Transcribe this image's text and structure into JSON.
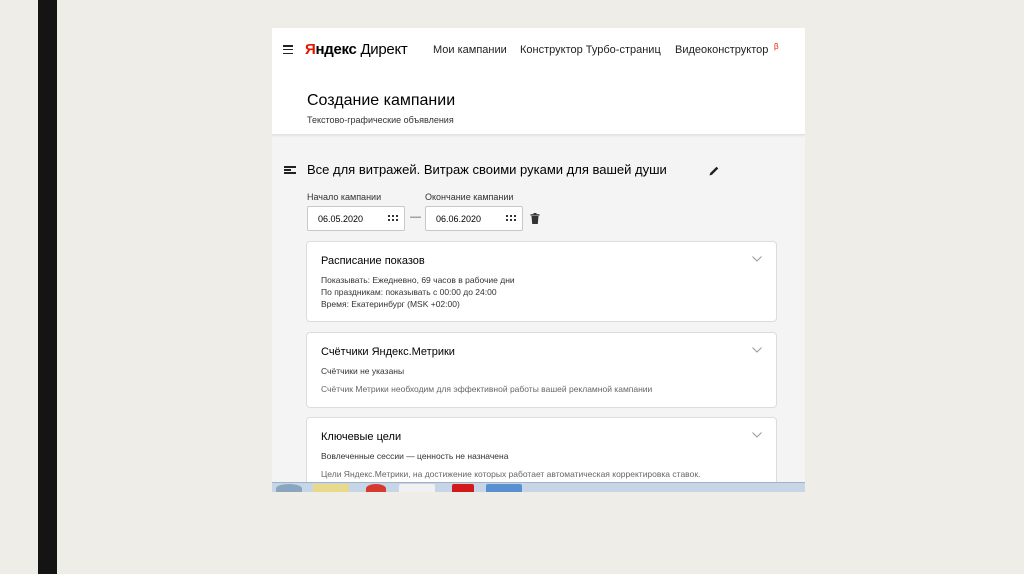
{
  "topnav": {
    "logo_ya": "Я",
    "logo_ndex": "ндекс",
    "logo_direct": "Директ",
    "items": [
      "Мои кампании",
      "Конструктор Турбо-страниц",
      "Видеоконструктор"
    ],
    "beta_label": "β"
  },
  "header": {
    "title": "Создание кампании",
    "subtitle": "Текстово-графические объявления"
  },
  "campaign": {
    "name": "Все для витражей. Витраж своими руками для вашей души"
  },
  "dates": {
    "start_label": "Начало кампании",
    "start_value": "06.05.2020",
    "end_label": "Окончание кампании",
    "end_value": "06.06.2020",
    "separator": "—"
  },
  "panels": {
    "schedule": {
      "title": "Расписание показов",
      "lines": [
        "Показывать: Ежедневно, 69 часов в рабочие дни",
        "По праздникам: показывать с 00:00 до 24:00",
        "Время: Екатеринбург (MSK +02:00)"
      ]
    },
    "metrika": {
      "title": "Счётчики Яндекс.Метрики",
      "lines": [
        "Счётчики не указаны",
        "Счётчик Метрики необходим для эффективной работы вашей рекламной кампании"
      ]
    },
    "goals": {
      "title": "Ключевые цели",
      "lines": [
        "Вовлеченные сессии — ценность не назначена",
        "Цели Яндекс.Метрики, на достижение которых работает автоматическая корректировка ставок."
      ]
    }
  },
  "colors": {
    "brand_red": "#e61400",
    "page_bg": "#efede8",
    "content_bg": "#f4f4f4"
  }
}
